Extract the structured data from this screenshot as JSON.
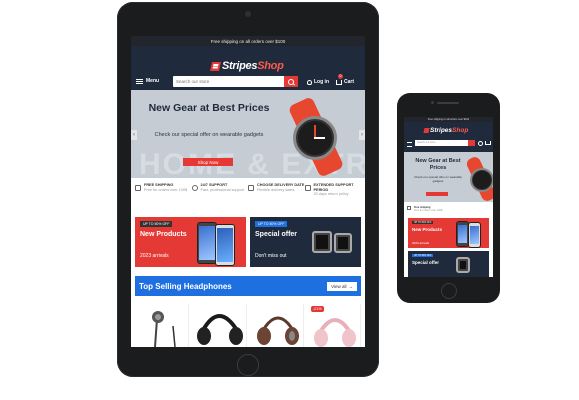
{
  "store": {
    "shipping_notice": "Free shipping on all orders over $100",
    "logo_stripes": "Stripes",
    "logo_shop": "Shop",
    "menu_label": "Menu",
    "search_placeholder": "Search our store",
    "login_label": "Log in",
    "cart_label": "Cart",
    "cart_count": "0"
  },
  "hero": {
    "title": "New Gear at Best Prices",
    "subtitle": "Check our special offer on wearable gadgets",
    "button": "Shop Now",
    "ghost_text": "HOME & EXTRA"
  },
  "features": [
    {
      "title": "Free shipping",
      "text": "Free for orders over 100$"
    },
    {
      "title": "24/7 Support",
      "text": "Fast, professional support"
    },
    {
      "title": "Choose delivery date",
      "text": "Flexible delivery dates"
    },
    {
      "title": "Extended support period",
      "text": "30 days return policy"
    }
  ],
  "promos": [
    {
      "tag": "UP TO 50% OFF",
      "title": "New Products",
      "text": "2023 arrivals"
    },
    {
      "tag": "UP TO 50% OFF",
      "title": "Special offer",
      "text": "Don't miss out"
    }
  ],
  "section": {
    "title": "Top Selling Headphones",
    "view_all": "View all"
  },
  "products": [
    {
      "badge": ""
    },
    {
      "badge": ""
    },
    {
      "badge": ""
    },
    {
      "badge": "-21%"
    }
  ],
  "colors": {
    "accent": "#e53935",
    "header": "#1f2a3c",
    "section_blue": "#1e6fe0"
  }
}
